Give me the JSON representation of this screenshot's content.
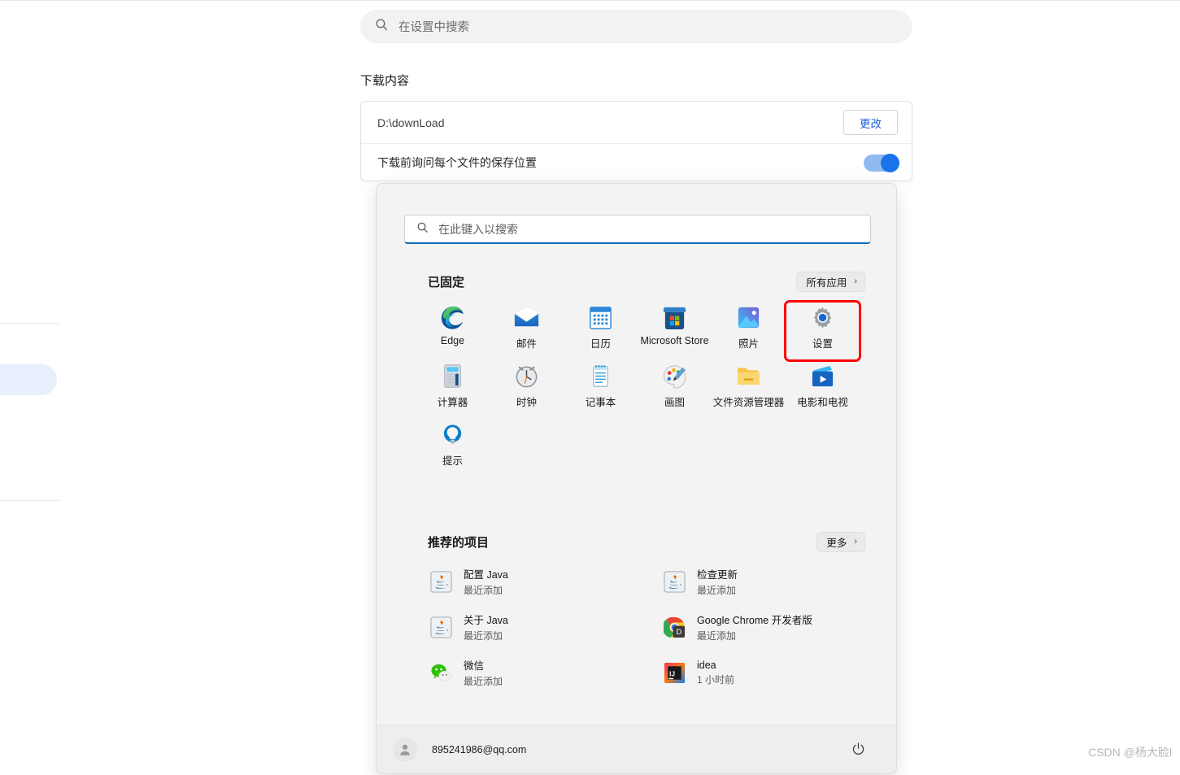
{
  "settings": {
    "search": {
      "placeholder": "在设置中搜索",
      "icon": "search-icon"
    },
    "section_title": "下载内容",
    "download_path": "D:\\downLoad",
    "change_button": "更改",
    "ask_location_label": "下载前询问每个文件的保存位置",
    "toggle_state": "on",
    "accent_color": "#1a73e8",
    "link_color": "#1b63d6"
  },
  "start_menu": {
    "search": {
      "placeholder": "在此键入以搜索",
      "icon": "search-icon",
      "underline_color": "#0f6cbd"
    },
    "pinned": {
      "title": "已固定",
      "all_apps_label": "所有应用",
      "apps": [
        {
          "label": "Edge",
          "icon": "edge-icon",
          "selected": false
        },
        {
          "label": "邮件",
          "icon": "mail-icon",
          "selected": false
        },
        {
          "label": "日历",
          "icon": "calendar-icon",
          "selected": false
        },
        {
          "label": "Microsoft Store",
          "icon": "microsoft-store-icon",
          "selected": false
        },
        {
          "label": "照片",
          "icon": "photos-icon",
          "selected": false
        },
        {
          "label": "设置",
          "icon": "settings-gear-icon",
          "selected": true
        },
        {
          "label": "计算器",
          "icon": "calculator-icon",
          "selected": false
        },
        {
          "label": "时钟",
          "icon": "clock-icon",
          "selected": false
        },
        {
          "label": "记事本",
          "icon": "notepad-icon",
          "selected": false
        },
        {
          "label": "画图",
          "icon": "paint-icon",
          "selected": false
        },
        {
          "label": "文件资源管理器",
          "icon": "file-explorer-icon",
          "selected": false
        },
        {
          "label": "电影和电视",
          "icon": "movies-tv-icon",
          "selected": false
        },
        {
          "label": "提示",
          "icon": "tips-bulb-icon",
          "selected": false
        }
      ]
    },
    "recommended": {
      "title": "推荐的项目",
      "more_label": "更多",
      "items": [
        {
          "name": "配置 Java",
          "sub": "最近添加",
          "icon": "java-icon"
        },
        {
          "name": "检查更新",
          "sub": "最近添加",
          "icon": "java-icon"
        },
        {
          "name": "关于 Java",
          "sub": "最近添加",
          "icon": "java-icon"
        },
        {
          "name": "Google Chrome 开发者版",
          "sub": "最近添加",
          "icon": "chrome-dev-icon"
        },
        {
          "name": "微信",
          "sub": "最近添加",
          "icon": "wechat-icon"
        },
        {
          "name": "idea",
          "sub": "1 小时前",
          "icon": "intellij-idea-icon"
        }
      ]
    },
    "footer": {
      "account_email": "895241986@qq.com",
      "avatar_icon": "user-avatar-icon",
      "power_icon": "power-icon"
    },
    "highlight_color": "#ff0000"
  },
  "watermark": "CSDN @杨大脸l"
}
